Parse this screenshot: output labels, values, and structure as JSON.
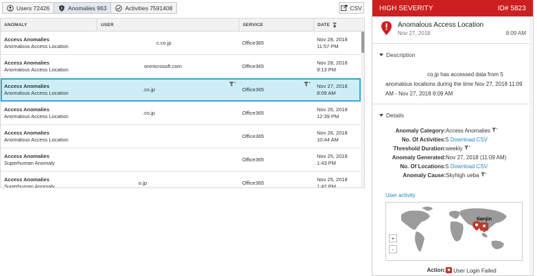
{
  "tabs": [
    {
      "label": "Users 72426",
      "icon": "user-icon"
    },
    {
      "label": "Anomalies 963",
      "icon": "shield-icon"
    },
    {
      "label": "Activities 7591408",
      "icon": "activity-icon"
    }
  ],
  "csv_button": {
    "label": "CSV",
    "icon": "export-icon"
  },
  "table": {
    "columns": [
      "ANOMALY",
      "USER",
      "SERVICE",
      "DATE"
    ],
    "sort_icon": "sort-desc-icon",
    "rows": [
      {
        "anomaly": "Access Anomalies",
        "subtype": "Anomalous Access Location",
        "user": "c.co.jp",
        "service": "Office365",
        "date": "Nov 28, 2018",
        "time": "11:57 PM"
      },
      {
        "anomaly": "Access Anomalies",
        "subtype": "Anomalous Access Location",
        "user": "onmicrosoft.com",
        "service": "Office365",
        "date": "Nov 28, 2018",
        "time": "9:13 PM"
      },
      {
        "anomaly": "Access Anomalies",
        "subtype": "Anomalous Access Location",
        "user": ".co.jp",
        "service": "Office365",
        "date": "Nov 27, 2018",
        "time": "8:09 AM"
      },
      {
        "anomaly": "Access Anomalies",
        "subtype": "Anomalous Access Location",
        "user": ".co.jp",
        "service": "Office365",
        "date": "Nov 26, 2018",
        "time": "12:39 PM"
      },
      {
        "anomaly": "Access Anomalies",
        "subtype": "Anomalous Access Location",
        "user": "",
        "service": "Office365",
        "date": "Nov 26, 2018",
        "time": "10:44 AM"
      },
      {
        "anomaly": "Access Anomalies",
        "subtype": "Superhuman Anomaly",
        "user": "",
        "service": "Office365",
        "date": "Nov 25, 2018",
        "time": "1:43 PM"
      },
      {
        "anomaly": "Access Anomalies",
        "subtype": "Superhuman Anomaly",
        "user": "o.jp",
        "service": "Office365",
        "date": "Nov 25, 2018",
        "time": "1:42 PM"
      }
    ]
  },
  "detail": {
    "severity": "HIGH SEVERITY",
    "id": "ID# 5823",
    "title": "Anomalous Access Location",
    "date": "Nov 27, 2018",
    "time": "8:09 AM",
    "description_header": "Description",
    "description_line1": "co.jp has accessed data from 5",
    "description_line2": "anomalous locations during the time Nov 27, 2018 11:09",
    "description_line3": "AM - Nov 27, 2018 8:09 AM",
    "details_header": "Details",
    "fields": [
      {
        "key": "Anomaly Category:",
        "value": "Access Anomalies",
        "link": ""
      },
      {
        "key": "No. Of Activities:",
        "value": "5",
        "link": "Download CSV"
      },
      {
        "key": "Threshold Duration:",
        "value": "weekly",
        "link": ""
      },
      {
        "key": "Anomaly Generated:",
        "value": "Nov 27, 2018 (11:09 AM)",
        "link": ""
      },
      {
        "key": "No. Of Locations:",
        "value": "5",
        "link": "Download CSV"
      },
      {
        "key": "Anomaly Cause:",
        "value": "Skyhigh ueba",
        "link": ""
      }
    ],
    "user_activity_label": "User activity",
    "map_city": "tianjin",
    "zoom_in": "+",
    "zoom_out": "-",
    "action_key": "Action:",
    "action_value": "User Login Failed"
  },
  "colors": {
    "severity": "#cc1f1f",
    "selected_row": "#cdeef7",
    "selected_border": "#38a8d6",
    "link": "#1e88c8"
  }
}
